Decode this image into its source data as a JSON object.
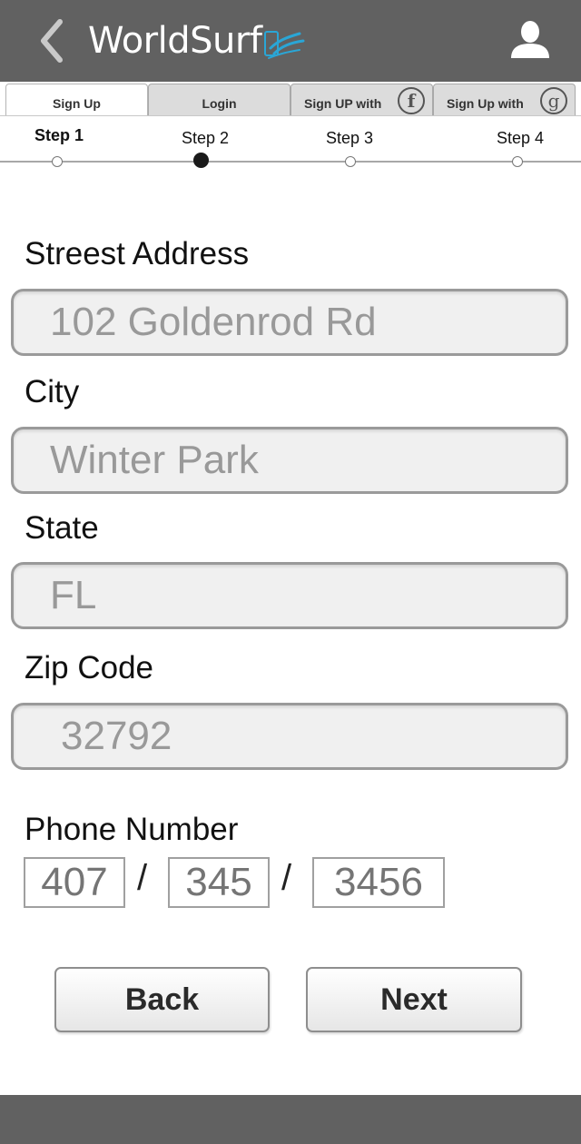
{
  "header": {
    "brand": "WorldSurf",
    "back_icon": "chevron-left-icon",
    "profile_icon": "user-icon",
    "colors": {
      "bar": "#616161",
      "logo_accent": "#2aa6d6"
    }
  },
  "tabs": [
    {
      "label": "Sign Up",
      "active": true
    },
    {
      "label": "Login",
      "active": false
    },
    {
      "label": "Sign UP with",
      "icon": "facebook-icon",
      "glyph": "f",
      "active": false
    },
    {
      "label": "Sign Up with",
      "icon": "google-icon",
      "glyph": "g",
      "active": false
    }
  ],
  "stepper": {
    "steps": [
      "Step 1",
      "Step 2",
      "Step 3",
      "Step 4"
    ],
    "filled_step": 2
  },
  "form": {
    "street": {
      "label": "Streest Address",
      "value": "102 Goldenrod Rd"
    },
    "city": {
      "label": "City",
      "value": "Winter Park"
    },
    "state": {
      "label": "State",
      "value": "FL"
    },
    "zip": {
      "label": "Zip Code",
      "value": "32792"
    },
    "phone": {
      "label": "Phone Number",
      "area": "407",
      "prefix": "345",
      "line": "3456",
      "separator": "/"
    }
  },
  "buttons": {
    "back": "Back",
    "next": "Next"
  }
}
